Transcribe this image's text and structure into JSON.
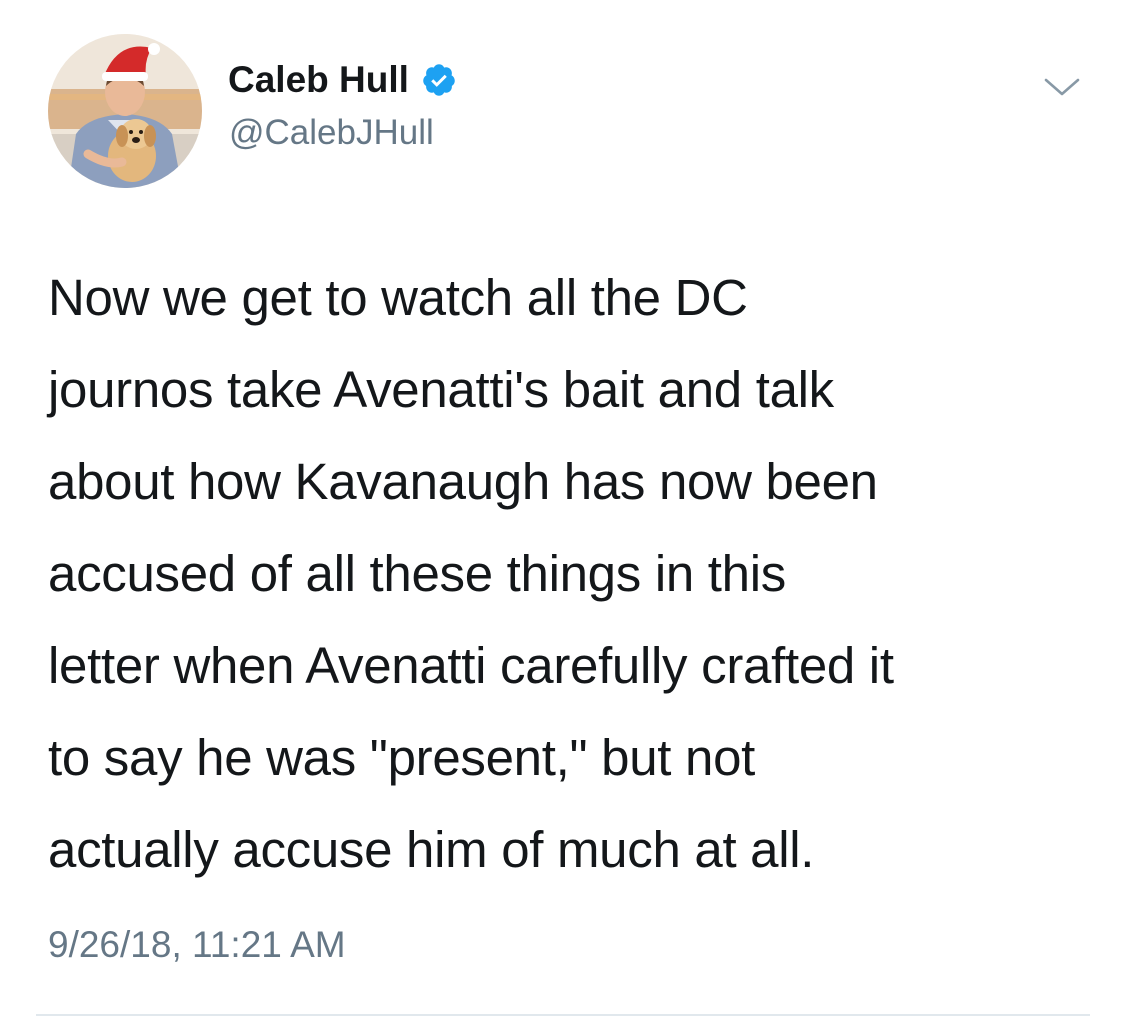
{
  "author": {
    "display_name": "Caleb Hull",
    "handle": "@CalebJHull",
    "verified": true,
    "verified_color": "#1da1f2",
    "avatar_description_icon": "avatar-icon"
  },
  "tweet": {
    "lines": [
      "Now we get to watch all the DC",
      "journos take Avenatti's bait and talk",
      "about how Kavanaugh has now been",
      "accused of all these things in this",
      "letter when Avenatti carefully crafted it",
      "to say he was \"present,\" but not",
      "actually accuse him of much at all."
    ],
    "timestamp": "9/26/18, 11:21 AM"
  },
  "icons": {
    "verified": "verified-badge-icon",
    "menu": "chevron-down-icon"
  },
  "colors": {
    "text_primary": "#14171a",
    "text_secondary": "#657786",
    "divider": "#e1e8ed"
  }
}
